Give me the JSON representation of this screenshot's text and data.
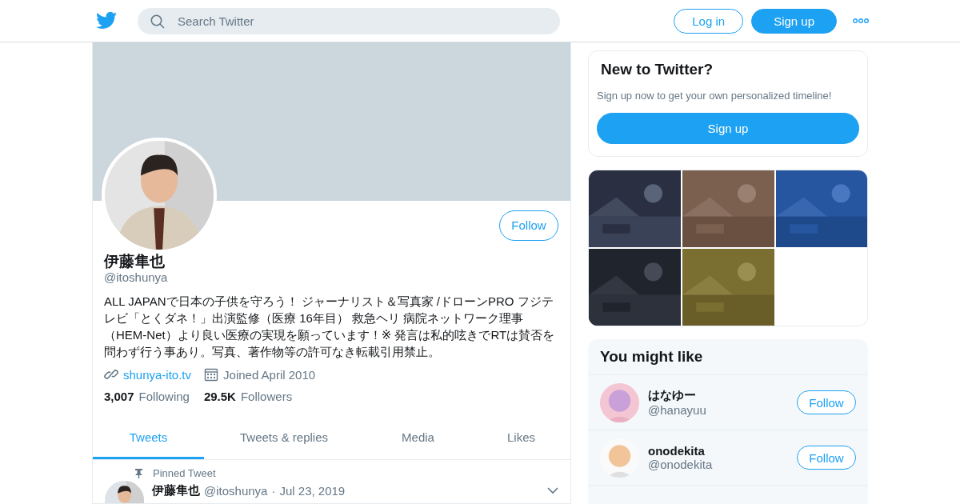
{
  "header": {
    "search": {
      "placeholder": "Search Twitter"
    },
    "login": "Log in",
    "signup": "Sign up"
  },
  "profile": {
    "follow": "Follow",
    "name": "伊藤隼也",
    "handle": "@itoshunya",
    "bio": "ALL JAPANで日本の子供を守ろう！ ジャーナリスト＆写真家 /ドローンPRO フジテレビ「とくダネ！」出演監修（医療 16年目） 救急ヘリ 病院ネットワーク理事（HEM-Net）より良い医療の実現を願っています！※ 発言は私的呟きでRTは賛否を問わず行う事あり。写真、著作物等の許可なき転載引用禁止。",
    "website": "shunya-ito.tv",
    "joined": "Joined April 2010",
    "stats": [
      {
        "count": "3,007",
        "label": "Following"
      },
      {
        "count": "29.5K",
        "label": "Followers"
      }
    ]
  },
  "tabs": [
    {
      "label": "Tweets",
      "selected": true
    },
    {
      "label": "Tweets & replies",
      "selected": false
    },
    {
      "label": "Media",
      "selected": false
    },
    {
      "label": "Likes",
      "selected": false
    }
  ],
  "pinned_tweet": {
    "pin_label": "Pinned Tweet",
    "name": "伊藤隼也",
    "handle": "@itoshunya",
    "separator": "·",
    "date": "Jul 23, 2019"
  },
  "signup_card": {
    "title": "New to Twitter?",
    "text": "Sign up now to get your own personalized timeline!",
    "button": "Sign up"
  },
  "media": [
    {
      "kind": "picture"
    },
    {
      "kind": "picture"
    },
    {
      "kind": "picture"
    },
    {
      "kind": "picture"
    },
    {
      "kind": "picture"
    },
    {
      "kind": "empty"
    }
  ],
  "you_might_like": {
    "title": "You might like",
    "accounts": [
      {
        "name": "はなゆー",
        "handle": "@hanayuu",
        "button": "Follow"
      },
      {
        "name": "onodekita",
        "handle": "@onodekita",
        "button": "Follow"
      }
    ]
  }
}
